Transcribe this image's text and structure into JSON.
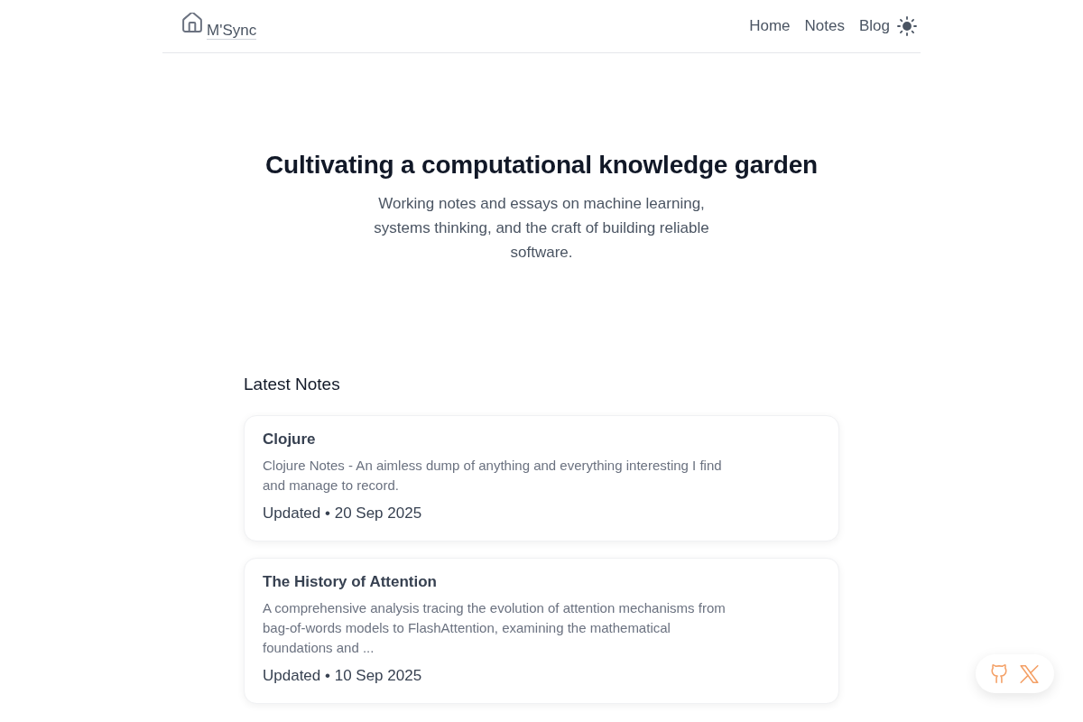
{
  "header": {
    "logo": {
      "label": "M'Sync"
    },
    "nav": [
      {
        "label": "Home"
      },
      {
        "label": "Notes"
      },
      {
        "label": "Blog"
      }
    ]
  },
  "hero": {
    "title": "Cultivating a computational knowledge garden",
    "subtitle": "Working notes and essays on machine learning, systems thinking, and the craft of building reliable software."
  },
  "latest": {
    "heading": "Latest Notes",
    "notes": [
      {
        "title": "Clojure",
        "description": "Clojure Notes - An aimless dump of anything and everything interesting I find and manage to record.",
        "updated": "Updated • 20 Sep 2025"
      },
      {
        "title": "The History of Attention",
        "description": "A comprehensive analysis tracing the evolution of attention mechanisms from bag-of-words models to FlashAttention, examining the mathematical foundations and ...",
        "updated": "Updated • 10 Sep 2025"
      }
    ]
  },
  "social": [
    {
      "kind": "github"
    },
    {
      "kind": "x"
    }
  ]
}
